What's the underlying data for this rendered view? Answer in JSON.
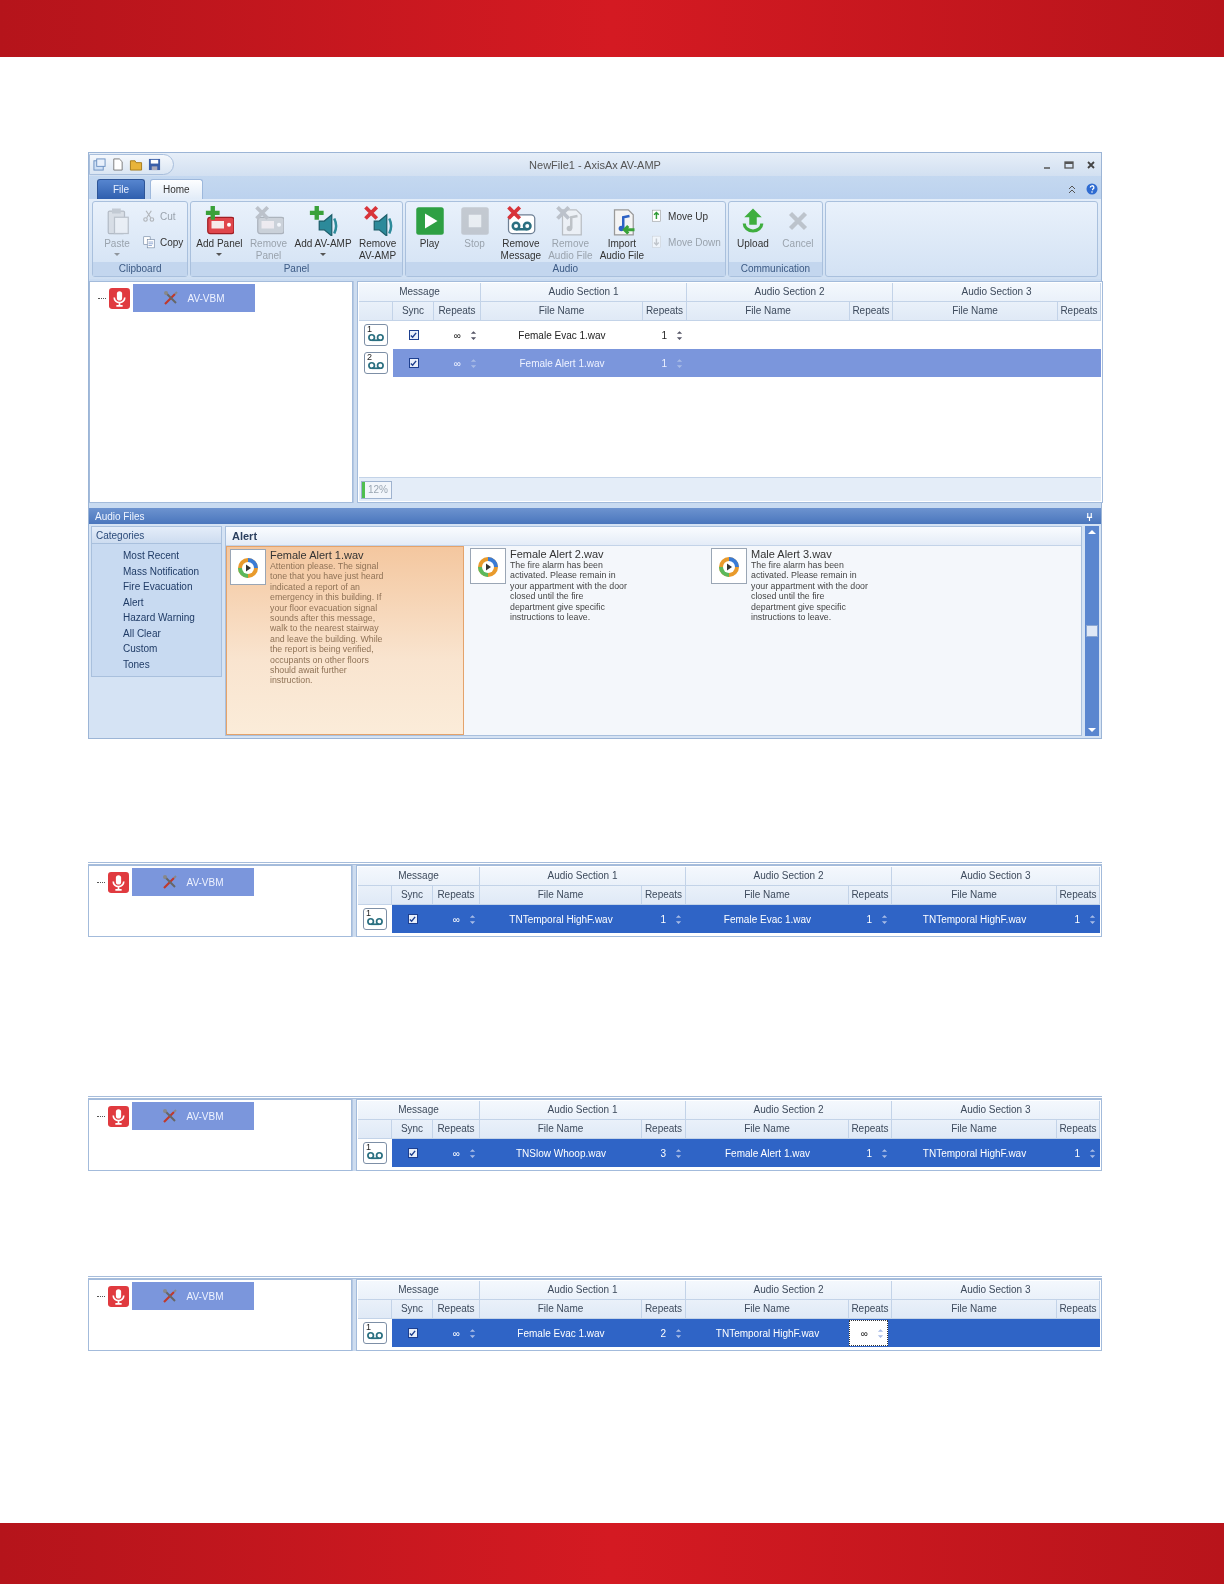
{
  "window": {
    "title": "NewFile1 - AxisAx AV-AMP"
  },
  "ribbon": {
    "tabs": [
      {
        "label": "File",
        "kind": "menu",
        "selected": false
      },
      {
        "label": "Home",
        "kind": "tab",
        "selected": true
      }
    ],
    "groups": [
      {
        "label": "Clipboard",
        "buttons": [
          {
            "label": "Paste",
            "kind": "large",
            "disabled": true,
            "dropdown": true
          },
          {
            "label": "Cut",
            "kind": "small",
            "disabled": true
          },
          {
            "label": "Copy",
            "kind": "small",
            "disabled": false
          }
        ]
      },
      {
        "label": "Panel",
        "buttons": [
          {
            "label": "Add Panel",
            "kind": "large",
            "disabled": false,
            "dropdown": true
          },
          {
            "label": "Remove\nPanel",
            "kind": "large",
            "disabled": true,
            "dropdown": false
          },
          {
            "label": "Add AV-AMP",
            "kind": "large",
            "disabled": false,
            "dropdown": true
          },
          {
            "label": "Remove\nAV-AMP",
            "kind": "large",
            "disabled": false,
            "dropdown": false
          }
        ]
      },
      {
        "label": "Audio",
        "buttons": [
          {
            "label": "Play",
            "kind": "large",
            "disabled": false,
            "dropdown": false
          },
          {
            "label": "Stop",
            "kind": "large",
            "disabled": true,
            "dropdown": false
          },
          {
            "label": "Remove\nMessage",
            "kind": "large",
            "disabled": false,
            "dropdown": false
          },
          {
            "label": "Remove\nAudio File",
            "kind": "large",
            "disabled": true,
            "dropdown": false
          },
          {
            "label": "Import\nAudio File",
            "kind": "large",
            "disabled": false,
            "dropdown": false
          },
          {
            "label": "Move Up",
            "kind": "small",
            "disabled": false
          },
          {
            "label": "Move Down",
            "kind": "small",
            "disabled": true
          }
        ]
      },
      {
        "label": "Communication",
        "buttons": [
          {
            "label": "Upload",
            "kind": "large",
            "disabled": false,
            "dropdown": false
          },
          {
            "label": "Cancel",
            "kind": "large",
            "disabled": true,
            "dropdown": false
          }
        ]
      }
    ]
  },
  "panel": {
    "tree": {
      "items": [
        {
          "label": "AV-VBM",
          "selected": true
        }
      ]
    },
    "grid": {
      "focused": false,
      "group_headers": [
        "Message",
        "Audio Section 1",
        "Audio Section 2",
        "Audio Section 3"
      ],
      "columns": [
        "Sync",
        "Repeats",
        "File Name",
        "Repeats",
        "File Name",
        "Repeats",
        "File Name",
        "Repeats"
      ],
      "rows": [
        {
          "number": "1",
          "selected": false,
          "sync": true,
          "repeats": "∞",
          "sections": [
            {
              "file": "Female Evac 1.wav",
              "repeats": "1",
              "editing": false
            }
          ]
        },
        {
          "number": "2",
          "selected": true,
          "sync": true,
          "repeats": "∞",
          "sections": [
            {
              "file": "Female Alert 1.wav",
              "repeats": "1",
              "editing": false
            }
          ]
        }
      ],
      "progress": {
        "label": "12%",
        "level": 0.12
      }
    }
  },
  "audio_files": {
    "title": "Audio Files",
    "categories": {
      "title": "Categories",
      "items": [
        "Most Recent",
        "Mass Notification",
        "Fire Evacuation",
        "Alert",
        "Hazard Warning",
        "All Clear",
        "Custom",
        "Tones"
      ]
    },
    "heading": "Alert",
    "files": [
      {
        "name": "Female Alert 1.wav",
        "selected": true,
        "description": "Attention please. The signal tone that you have just heard indicated a report of an emergency in this building. If your floor evacuation signal sounds after this message, walk to the nearest stairway and leave the building. While the report is being verified, occupants on other floors should await further instruction."
      },
      {
        "name": "Female Alert 2.wav",
        "selected": false,
        "description": "The fire alarm has been activated. Please remain in your appartment with the door closed until the fire department give specific instructions to leave."
      },
      {
        "name": "Male Alert 3.wav",
        "selected": false,
        "description": "The fire alarm has been activated. Please remain in your appartment with the door closed until the fire department give specific instructions to leave."
      }
    ]
  },
  "snippets": [
    {
      "tree": {
        "items": [
          {
            "label": "AV-VBM",
            "selected": true
          }
        ]
      },
      "grid": {
        "focused": true,
        "group_headers": [
          "Message",
          "Audio Section 1",
          "Audio Section 2",
          "Audio Section 3"
        ],
        "columns": [
          "Sync",
          "Repeats",
          "File Name",
          "Repeats",
          "File Name",
          "Repeats",
          "File Name",
          "Repeats"
        ],
        "rows": [
          {
            "number": "1",
            "selected": true,
            "sync": true,
            "repeats": "∞",
            "sections": [
              {
                "file": "TNTemporal HighF.wav",
                "repeats": "1",
                "editing": false
              },
              {
                "file": "Female Evac 1.wav",
                "repeats": "1",
                "editing": false
              },
              {
                "file": "TNTemporal HighF.wav",
                "repeats": "1",
                "editing": false
              }
            ]
          }
        ]
      }
    },
    {
      "tree": {
        "items": [
          {
            "label": "AV-VBM",
            "selected": true
          }
        ]
      },
      "grid": {
        "focused": true,
        "group_headers": [
          "Message",
          "Audio Section 1",
          "Audio Section 2",
          "Audio Section 3"
        ],
        "columns": [
          "Sync",
          "Repeats",
          "File Name",
          "Repeats",
          "File Name",
          "Repeats",
          "File Name",
          "Repeats"
        ],
        "rows": [
          {
            "number": "1",
            "selected": true,
            "sync": true,
            "repeats": "∞",
            "sections": [
              {
                "file": "TNSlow Whoop.wav",
                "repeats": "3",
                "editing": false
              },
              {
                "file": "Female Alert 1.wav",
                "repeats": "1",
                "editing": false
              },
              {
                "file": "TNTemporal HighF.wav",
                "repeats": "1",
                "editing": false
              }
            ]
          }
        ]
      }
    },
    {
      "tree": {
        "items": [
          {
            "label": "AV-VBM",
            "selected": true
          }
        ]
      },
      "grid": {
        "focused": true,
        "group_headers": [
          "Message",
          "Audio Section 1",
          "Audio Section 2",
          "Audio Section 3"
        ],
        "columns": [
          "Sync",
          "Repeats",
          "File Name",
          "Repeats",
          "File Name",
          "Repeats",
          "File Name",
          "Repeats"
        ],
        "rows": [
          {
            "number": "1",
            "selected": true,
            "sync": true,
            "repeats": "∞",
            "sections": [
              {
                "file": "Female Evac 1.wav",
                "repeats": "2",
                "editing": false
              },
              {
                "file": "TNTemporal HighF.wav",
                "repeats": "∞",
                "editing": true
              }
            ]
          }
        ]
      }
    }
  ]
}
